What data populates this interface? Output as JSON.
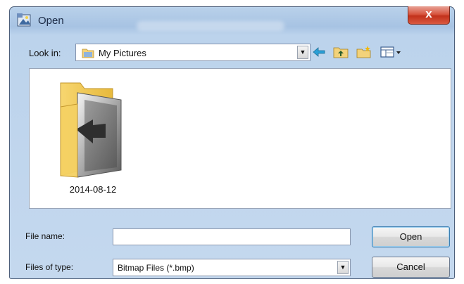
{
  "dialog": {
    "title": "Open",
    "close_label": "x"
  },
  "lookin": {
    "label": "Look in:",
    "value": "My Pictures",
    "icons": [
      "back-arrow-icon",
      "up-folder-icon",
      "new-folder-icon",
      "view-menu-icon"
    ]
  },
  "files": [
    {
      "name": "2014-08-12",
      "icon": "folder-icon"
    }
  ],
  "filename": {
    "label": "File name:",
    "value": "",
    "placeholder": ""
  },
  "filetype": {
    "label": "Files of type:",
    "value": "Bitmap Files (*.bmp)"
  },
  "buttons": {
    "open": "Open",
    "cancel": "Cancel"
  },
  "colors": {
    "titlebar": "#a7c3e3",
    "close": "#c2321c",
    "folder": "#f2c94c"
  }
}
